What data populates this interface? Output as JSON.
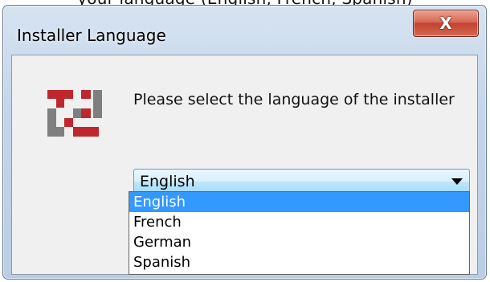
{
  "page_caption": "your language (English, French, Spanish)",
  "window": {
    "title": "Installer Language",
    "close_glyph": "X",
    "prompt": "Please select the language of the installer"
  },
  "icons": {
    "app_logo": "installer-logo-icon",
    "close": "close-icon",
    "dropdown": "chevron-down-icon"
  },
  "language_select": {
    "value": "English",
    "options": [
      "English",
      "French",
      "German",
      "Spanish"
    ],
    "highlighted_index": 0
  },
  "colors": {
    "logo_red": "#c0272d",
    "logo_gray": "#7f7f7f",
    "highlight": "#3399ff",
    "close_red": "#c24330"
  }
}
